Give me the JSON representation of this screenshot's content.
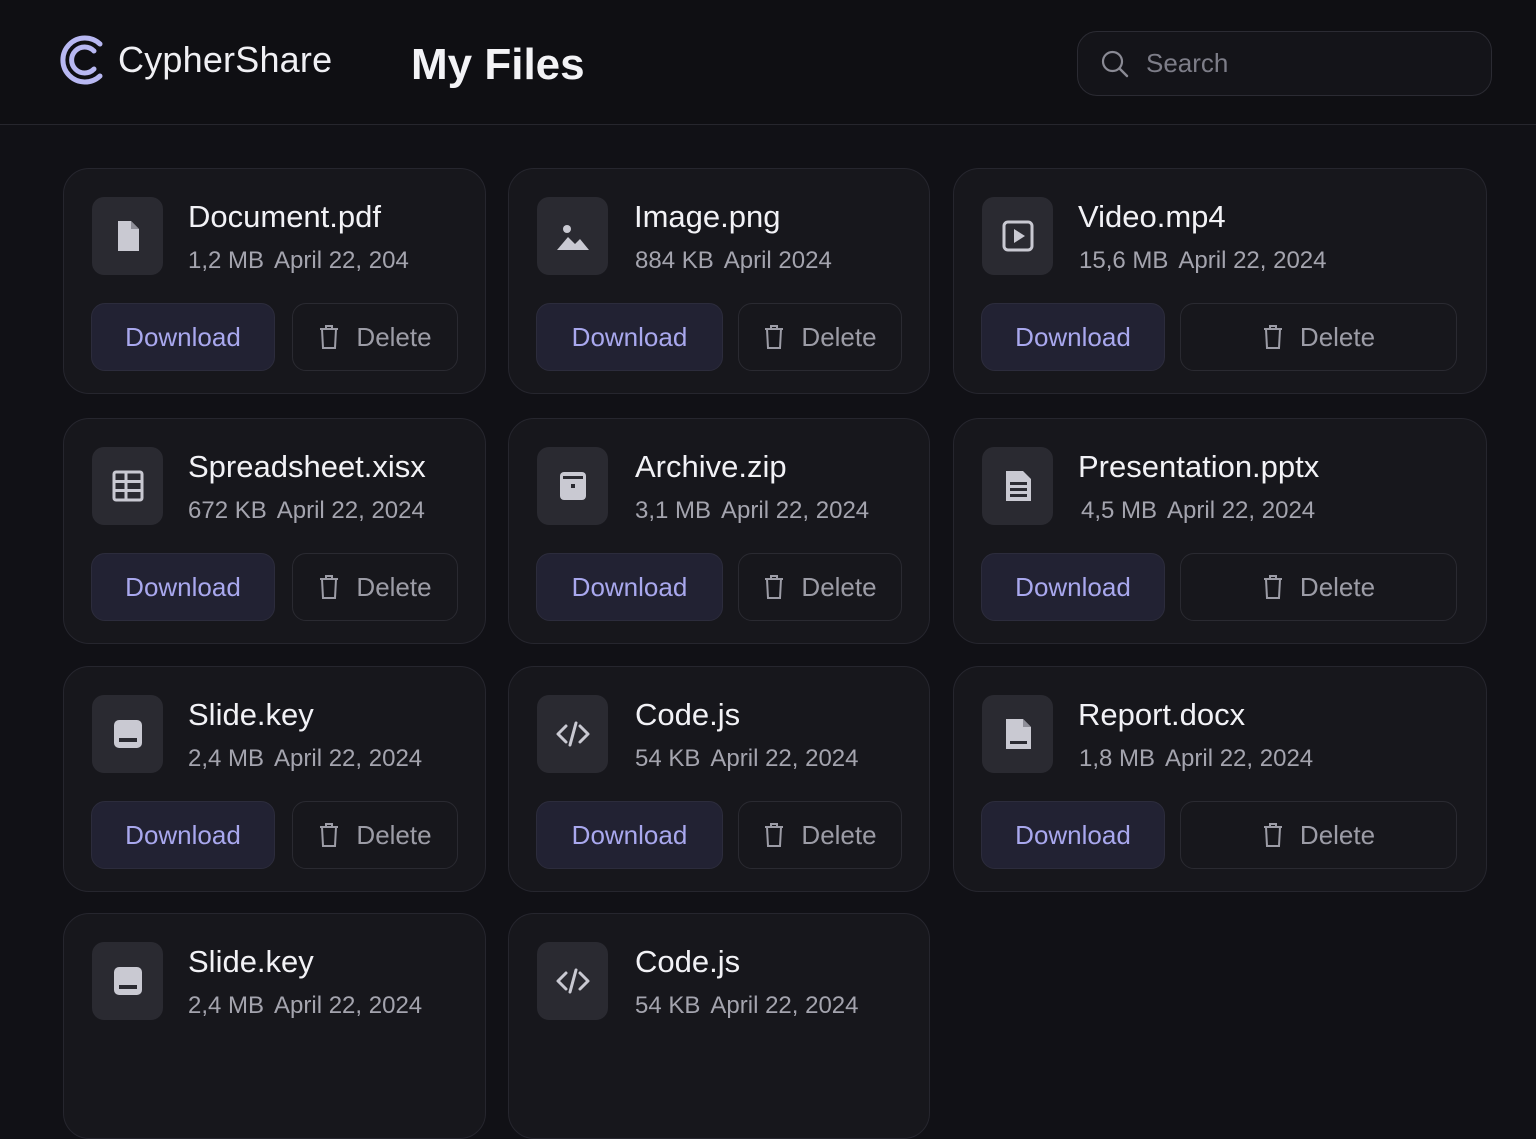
{
  "app": {
    "name": "CypherShare"
  },
  "page": {
    "title": "My Files"
  },
  "search": {
    "placeholder": "Search"
  },
  "actions": {
    "download_label": "Download",
    "delete_label": "Delete"
  },
  "colors": {
    "accent": "#a9a8ee",
    "background": "#111116",
    "card": "#17171c"
  },
  "files": [
    {
      "name": "Document.pdf",
      "size": "1,2 MB",
      "date": "April 22, 204",
      "icon": "document-icon"
    },
    {
      "name": "Image.png",
      "size": "884 KB",
      "date": "April 2024",
      "icon": "image-icon"
    },
    {
      "name": "Video.mp4",
      "size": "15,6 MB",
      "date": "April 22, 2024",
      "icon": "video-icon"
    },
    {
      "name": "Spreadsheet.xisx",
      "size": "672 KB",
      "date": "April 22, 2024",
      "icon": "spreadsheet-icon"
    },
    {
      "name": "Archive.zip",
      "size": "3,1 MB",
      "date": "April 22, 2024",
      "icon": "archive-icon"
    },
    {
      "name": "Presentation.pptx",
      "size": "4,5 MB",
      "date": "April 22, 2024",
      "icon": "presentation-icon"
    },
    {
      "name": "Slide.key",
      "size": "2,4 MB",
      "date": "April 22, 2024",
      "icon": "slide-icon"
    },
    {
      "name": "Code.js",
      "size": "54 KB",
      "date": "April 22, 2024",
      "icon": "code-icon"
    },
    {
      "name": "Report.docx",
      "size": "1,8 MB",
      "date": "April 22, 2024",
      "icon": "report-icon"
    },
    {
      "name": "Slide.key",
      "size": "2,4 MB",
      "date": "April 22, 2024",
      "icon": "slide-icon"
    },
    {
      "name": "Code.js",
      "size": "54 KB",
      "date": "April 22, 2024",
      "icon": "code-icon"
    }
  ]
}
